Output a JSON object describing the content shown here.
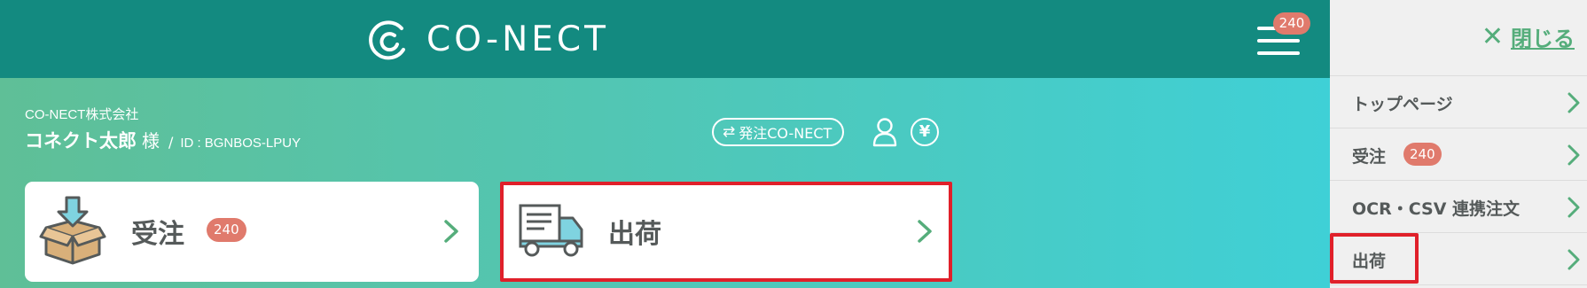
{
  "header": {
    "logo_text": "CO-NECT",
    "menu_badge": "240"
  },
  "account": {
    "company": "CO-NECT株式会社",
    "user_name": "コネクト太郎",
    "honorific": "様",
    "separator": "/",
    "id_label": "ID :",
    "id_value": "BGNBOS-LPUY"
  },
  "toolbar": {
    "order_switch_label": "発注CO-NECT",
    "order_switch_icon": "⇄",
    "yen_symbol": "¥"
  },
  "cards": {
    "receive": {
      "label": "受注",
      "badge": "240"
    },
    "ship": {
      "label": "出荷"
    }
  },
  "side_menu": {
    "close_label": "閉じる",
    "close_icon": "✕",
    "items": [
      {
        "label": "トップページ"
      },
      {
        "label": "受注",
        "badge": "240"
      },
      {
        "label": "OCR・CSV 連携注文"
      },
      {
        "label": "出荷"
      }
    ]
  },
  "colors": {
    "header": "#138a80",
    "accent_green": "#55ad7b",
    "badge": "#e07a6c",
    "highlight": "#e0202a"
  }
}
